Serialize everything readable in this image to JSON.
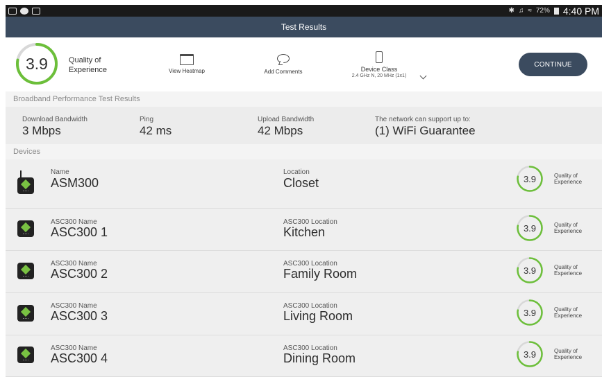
{
  "status_bar": {
    "battery": "72%",
    "time": "4:40 PM"
  },
  "title": "Test Results",
  "summary": {
    "qoe_value": "3.9",
    "qoe_label": "Quality of Experience",
    "view_heatmap": "View Heatmap",
    "add_comments": "Add Comments",
    "device_class_label": "Device Class",
    "device_class_value": "2.4 GHz N, 20 MHz (1x1)",
    "continue": "CONTINUE"
  },
  "broadband": {
    "section_title": "Broadband Performance Test Results",
    "metrics": [
      {
        "label": "Download Bandwidth",
        "value": "3 Mbps"
      },
      {
        "label": "Ping",
        "value": "42 ms"
      },
      {
        "label": "Upload Bandwidth",
        "value": "42 Mbps"
      },
      {
        "label": "The network can support up to:",
        "value": "(1) WiFi Guarantee"
      }
    ]
  },
  "devices": {
    "section_title": "Devices",
    "rows": [
      {
        "name_label": "Name",
        "name": "ASM300",
        "location_label": "Location",
        "location": "Closet",
        "qoe": "3.9",
        "qoe_label": "Quality of Experience"
      },
      {
        "name_label": "ASC300 Name",
        "name": "ASC300 1",
        "location_label": "ASC300 Location",
        "location": "Kitchen",
        "qoe": "3.9",
        "qoe_label": "Quality of Experience"
      },
      {
        "name_label": "ASC300 Name",
        "name": "ASC300 2",
        "location_label": "ASC300 Location",
        "location": "Family Room",
        "qoe": "3.9",
        "qoe_label": "Quality of Experience"
      },
      {
        "name_label": "ASC300 Name",
        "name": "ASC300 3",
        "location_label": "ASC300 Location",
        "location": "Living Room",
        "qoe": "3.9",
        "qoe_label": "Quality of Experience"
      },
      {
        "name_label": "ASC300 Name",
        "name": "ASC300 4",
        "location_label": "ASC300 Location",
        "location": "Dining Room",
        "qoe": "3.9",
        "qoe_label": "Quality of Experience"
      }
    ]
  },
  "colors": {
    "header_bg": "#3b4b5f",
    "gauge_green": "#6cbf3a",
    "gauge_track": "#d8d8d8",
    "device_green": "#79c142"
  }
}
